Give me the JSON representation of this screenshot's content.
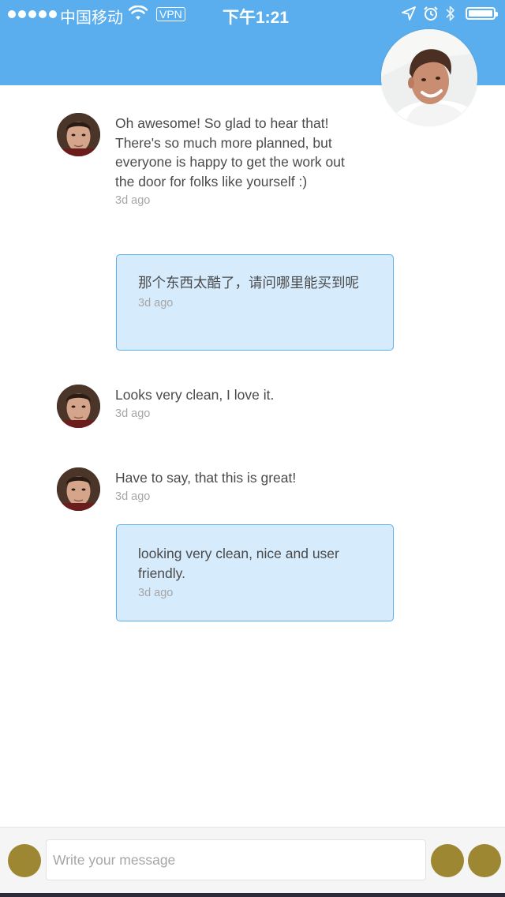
{
  "status_bar": {
    "carrier": "中国移动",
    "vpn": "VPN",
    "time": "下午1:21",
    "battery_level": 1.0
  },
  "messages": [
    {
      "type": "incoming",
      "text": "Oh awesome! So glad to hear that! There's so much more planned, but everyone is happy to get the work out the door for folks like yourself :)",
      "time": "3d ago"
    },
    {
      "type": "outgoing",
      "text": "那个东西太酷了，请问哪里能买到呢",
      "time": "3d ago"
    },
    {
      "type": "incoming",
      "text": "Looks very clean, I love it.",
      "time": "3d ago"
    },
    {
      "type": "incoming",
      "text": "Have to say, that this is great!",
      "time": "3d ago"
    },
    {
      "type": "outgoing",
      "text": "looking very clean, nice and user friendly.",
      "time": "3d ago"
    }
  ],
  "composer": {
    "placeholder": "Write your message"
  },
  "colors": {
    "header": "#5aaeee",
    "bubble": "#d6ebfc",
    "bubble_border": "#5aaeee",
    "button": "#9e8732"
  }
}
